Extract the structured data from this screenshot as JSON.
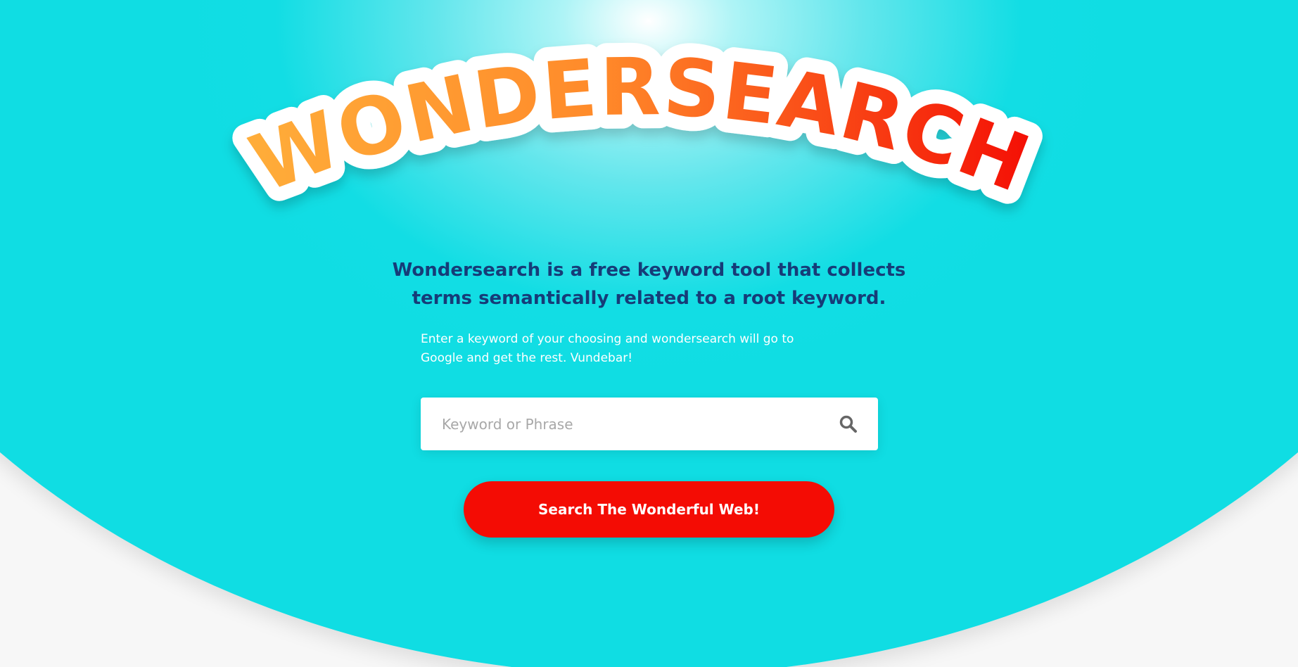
{
  "logo": {
    "text": "WONDERSEARCH"
  },
  "hero": {
    "tagline_line1": "Wondersearch is a free keyword tool that collects",
    "tagline_line2": "terms semantically related to a root keyword.",
    "description_line1": "Enter a keyword of your choosing and wondersearch will go to",
    "description_line2": "Google and get the rest. Vundebar!"
  },
  "search": {
    "placeholder": "Keyword or Phrase",
    "value": "",
    "button_label": "Search The Wonderful Web!"
  },
  "colors": {
    "background_cyan": "#10dde3",
    "tagline_navy": "#163c78",
    "button_red": "#f40c04",
    "logo_orange": "#ffae3a",
    "logo_red": "#f41008"
  }
}
